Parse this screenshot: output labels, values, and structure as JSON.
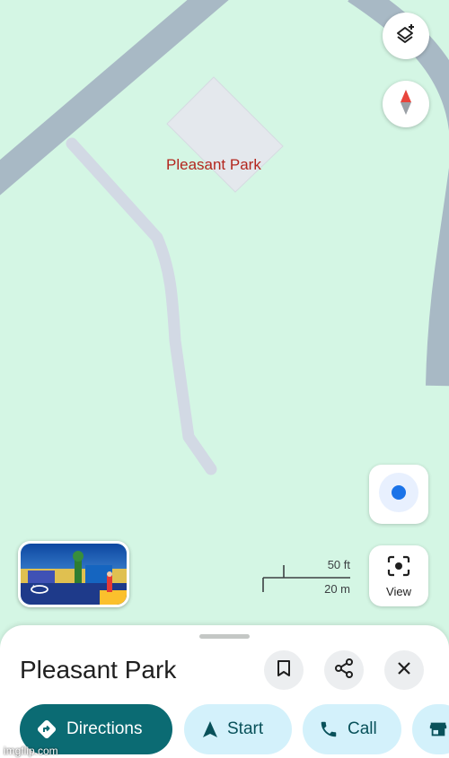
{
  "map": {
    "place_label": "Pleasant Park",
    "scale_imperial": "50 ft",
    "scale_metric": "20 m",
    "view_label": "View",
    "colors": {
      "park": "#d4f6e4",
      "road": "#a8b9c5",
      "path": "#d2d9e4",
      "building": "#e4e8ed",
      "label": "#b3261e",
      "location_dot": "#1a73e8"
    },
    "icons": [
      "layers-icon",
      "compass-icon",
      "my-location-icon",
      "lens-view-icon",
      "street-view-360-icon"
    ]
  },
  "sheet": {
    "title": "Pleasant Park",
    "actions": {
      "directions": "Directions",
      "start": "Start",
      "call": "Call"
    },
    "icons": [
      "bookmark-icon",
      "share-icon",
      "close-icon",
      "directions-icon",
      "navigation-arrow-icon",
      "phone-icon",
      "store-icon"
    ],
    "colors": {
      "primary": "#0b6b73",
      "chip_bg": "#d3f1fb",
      "chip_text": "#08515a"
    }
  },
  "watermark": "imgflip.com"
}
